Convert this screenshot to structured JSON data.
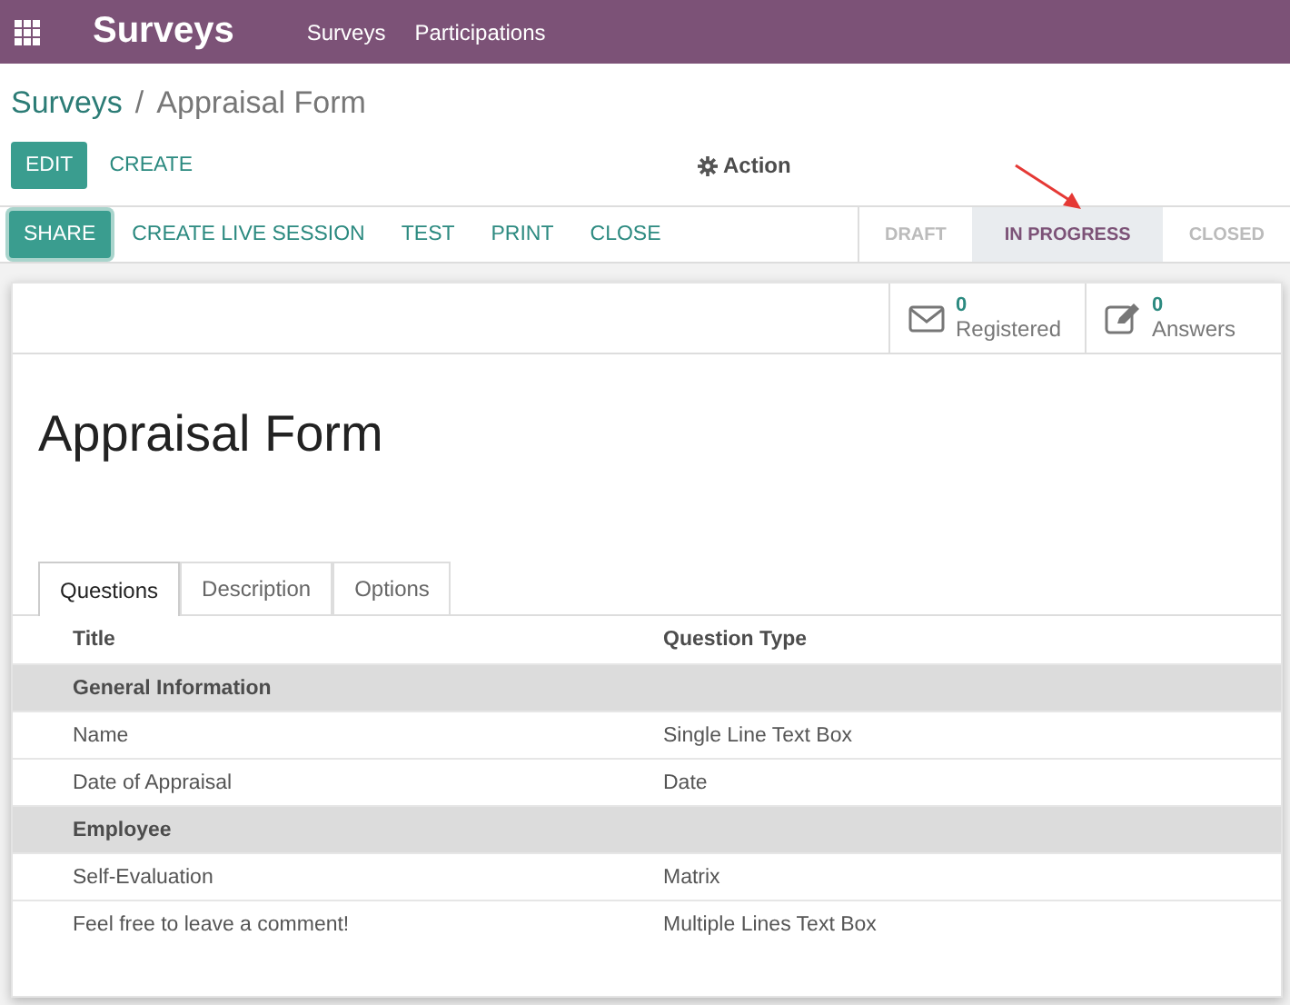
{
  "navbar": {
    "app_title": "Surveys",
    "menu": [
      "Surveys",
      "Participations"
    ]
  },
  "breadcrumb": {
    "parent": "Surveys",
    "separator": "/",
    "current": "Appraisal Form"
  },
  "control_buttons": [
    {
      "label": "EDIT",
      "kind": "primary"
    },
    {
      "label": "CREATE",
      "kind": "link"
    }
  ],
  "action_menu": "Action",
  "header_buttons": [
    {
      "label": "SHARE",
      "kind": "primary"
    },
    {
      "label": "CREATE LIVE SESSION",
      "kind": "link"
    },
    {
      "label": "TEST",
      "kind": "link"
    },
    {
      "label": "PRINT",
      "kind": "link"
    },
    {
      "label": "CLOSE",
      "kind": "link"
    }
  ],
  "stages": [
    {
      "label": "DRAFT",
      "selected": false
    },
    {
      "label": "IN PROGRESS",
      "selected": true
    },
    {
      "label": "CLOSED",
      "selected": false
    }
  ],
  "stat_buttons": [
    {
      "kind": "envelope",
      "value": "0",
      "label": "Registered"
    },
    {
      "kind": "pencil",
      "value": "0",
      "label": "Answers"
    }
  ],
  "form_title": "Appraisal Form",
  "tabs": [
    {
      "label": "Questions",
      "selected": true
    },
    {
      "label": "Description",
      "selected": false
    },
    {
      "label": "Options",
      "selected": false
    }
  ],
  "table": {
    "columns": [
      "Title",
      "Question Type"
    ],
    "rows": [
      {
        "kind": "section",
        "cells": [
          "General Information"
        ]
      },
      {
        "kind": "line",
        "cells": [
          "Name",
          "Single Line Text Box"
        ]
      },
      {
        "kind": "line",
        "cells": [
          "Date of Appraisal",
          "Date"
        ]
      },
      {
        "kind": "section",
        "cells": [
          "Employee"
        ]
      },
      {
        "kind": "line",
        "cells": [
          "Self-Evaluation",
          "Matrix"
        ]
      },
      {
        "kind": "line",
        "cells": [
          "Feel free to leave a comment!",
          "Multiple Lines Text Box"
        ]
      }
    ]
  }
}
